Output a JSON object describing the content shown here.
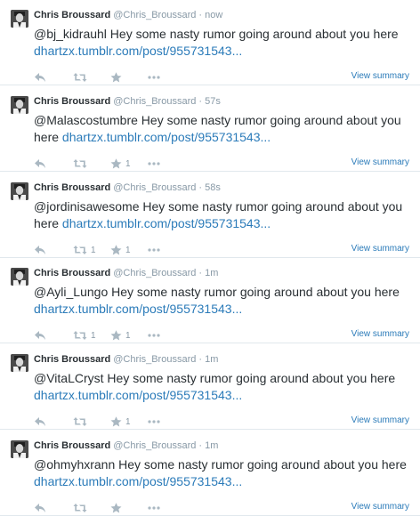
{
  "colors": {
    "link": "#2b7bb9",
    "muted": "#8899a6",
    "icon": "#aab8c2",
    "divider": "#e1e8ed"
  },
  "tweets": [
    {
      "name": "Chris Broussard",
      "handle": "@Chris_Broussard",
      "sep": "·",
      "time": "now",
      "text_before": "@bj_kidrauhl Hey some nasty rumor going around about you here ",
      "link": "dhartzx.tumblr.com/post/955731543...",
      "retweet_count": "",
      "favorite_count": "",
      "summary": "View summary"
    },
    {
      "name": "Chris Broussard",
      "handle": "@Chris_Broussard",
      "sep": "·",
      "time": "57s",
      "text_before": "@Malascostumbre Hey some nasty rumor going around about you here ",
      "link": "dhartzx.tumblr.com/post/955731543...",
      "retweet_count": "",
      "favorite_count": "1",
      "summary": "View summary"
    },
    {
      "name": "Chris Broussard",
      "handle": "@Chris_Broussard",
      "sep": "·",
      "time": "58s",
      "text_before": "@jordinisawesome Hey some nasty rumor going around about you here ",
      "link": "dhartzx.tumblr.com/post/955731543...",
      "retweet_count": "1",
      "favorite_count": "1",
      "summary": "View summary"
    },
    {
      "name": "Chris Broussard",
      "handle": "@Chris_Broussard",
      "sep": "·",
      "time": "1m",
      "text_before": "@Ayli_Lungo Hey some nasty rumor going around about you here ",
      "link": "dhartzx.tumblr.com/post/955731543...",
      "retweet_count": "1",
      "favorite_count": "1",
      "summary": "View summary"
    },
    {
      "name": "Chris Broussard",
      "handle": "@Chris_Broussard",
      "sep": "·",
      "time": "1m",
      "text_before": "@VitaLCryst Hey some nasty rumor going around about you here ",
      "link": "dhartzx.tumblr.com/post/955731543...",
      "retweet_count": "",
      "favorite_count": "1",
      "summary": "View summary"
    },
    {
      "name": "Chris Broussard",
      "handle": "@Chris_Broussard",
      "sep": "·",
      "time": "1m",
      "text_before": "@ohmyhxrann Hey some nasty rumor going around about you here ",
      "link": "dhartzx.tumblr.com/post/955731543...",
      "retweet_count": "",
      "favorite_count": "",
      "summary": "View summary"
    }
  ]
}
